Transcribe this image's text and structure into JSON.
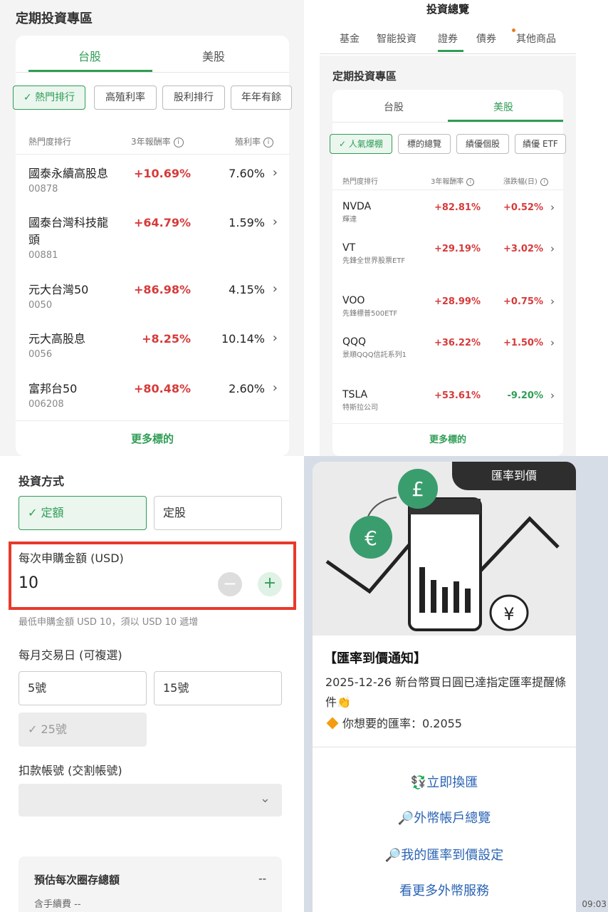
{
  "panel_a": {
    "title": "定期投資專區",
    "tabs": [
      {
        "label": "台股"
      },
      {
        "label": "美股"
      }
    ],
    "chips": [
      {
        "label": "熱門排行"
      },
      {
        "label": "高殖利率"
      },
      {
        "label": "股利排行"
      },
      {
        "label": "年年有餘"
      }
    ],
    "columns": {
      "rank": "熱門度排行",
      "return": "3年報酬率",
      "yield": "殖利率"
    },
    "rows": [
      {
        "name": "國泰永續高股息",
        "code": "00878",
        "return": "+10.69%",
        "yield": "7.60%"
      },
      {
        "name": "國泰台灣科技龍頭",
        "code": "00881",
        "return": "+64.79%",
        "yield": "1.59%"
      },
      {
        "name": "元大台灣50",
        "code": "0050",
        "return": "+86.98%",
        "yield": "4.15%"
      },
      {
        "name": "元大高股息",
        "code": "0056",
        "return": "+8.25%",
        "yield": "10.14%"
      },
      {
        "name": "富邦台50",
        "code": "006208",
        "return": "+80.48%",
        "yield": "2.60%"
      }
    ],
    "more": "更多標的"
  },
  "panel_b": {
    "header": "投資總覽",
    "nav": [
      {
        "label": "基金"
      },
      {
        "label": "智能投資"
      },
      {
        "label": "證券"
      },
      {
        "label": "債券"
      },
      {
        "label": "其他商品"
      }
    ],
    "section_title": "定期投資專區",
    "tabs": [
      {
        "label": "台股"
      },
      {
        "label": "美股"
      }
    ],
    "chips": [
      {
        "label": "人氣爆棚"
      },
      {
        "label": "標的總覽"
      },
      {
        "label": "績優個股"
      },
      {
        "label": "績優 ETF"
      }
    ],
    "columns": {
      "rank": "熱門度排行",
      "return": "3年報酬率",
      "daily": "漲跌幅(日)"
    },
    "rows": [
      {
        "name": "NVDA",
        "sub": "輝達",
        "return": "+82.81%",
        "daily": "+0.52%",
        "up": true
      },
      {
        "name": "VT",
        "sub": "先鋒全世界股票ETF",
        "return": "+29.19%",
        "daily": "+3.02%",
        "up": true
      },
      {
        "name": "VOO",
        "sub": "先鋒標普500ETF",
        "return": "+28.99%",
        "daily": "+0.75%",
        "up": true
      },
      {
        "name": "QQQ",
        "sub": "景順QQQ信託系列1",
        "return": "+36.22%",
        "daily": "+1.50%",
        "up": true
      },
      {
        "name": "TSLA",
        "sub": "特斯拉公司",
        "return": "+53.61%",
        "daily": "-9.20%",
        "up": false
      }
    ],
    "more": "更多標的"
  },
  "panel_c": {
    "method_label": "投資方式",
    "method_options": [
      {
        "label": "定額"
      },
      {
        "label": "定股"
      }
    ],
    "amount_label": "每次申購金額 (USD)",
    "amount_value": "10",
    "amount_hint": "最低申購金額 USD 10，須以 USD 10 遞增",
    "day_label": "每月交易日 (可複選)",
    "days": [
      {
        "label": "5號"
      },
      {
        "label": "15號"
      },
      {
        "label": "25號"
      }
    ],
    "account_label": "扣款帳號 (交割帳號)",
    "summary_title": "預估每次圈存總額",
    "summary_value": "--",
    "summary_sub": "含手續費 --"
  },
  "panel_d": {
    "tag": "匯率到價",
    "title": "【匯率到價通知】",
    "body": "2025-12-26 新台幣買日圓已達指定匯率提醒條件👏",
    "rate_line": "你想要的匯率：0.2055",
    "actions": [
      {
        "label": "💱立即換匯"
      },
      {
        "label": "🔎外幣帳戶總覽"
      },
      {
        "label": "🔎我的匯率到價設定"
      },
      {
        "label": "看更多外幣服務"
      }
    ],
    "time": "09:03"
  },
  "colors": {
    "accent": "#2f9d55",
    "up": "#d73a3a",
    "down": "#2f9d55",
    "highlight_box": "#e8392b",
    "link": "#2a63b3"
  }
}
